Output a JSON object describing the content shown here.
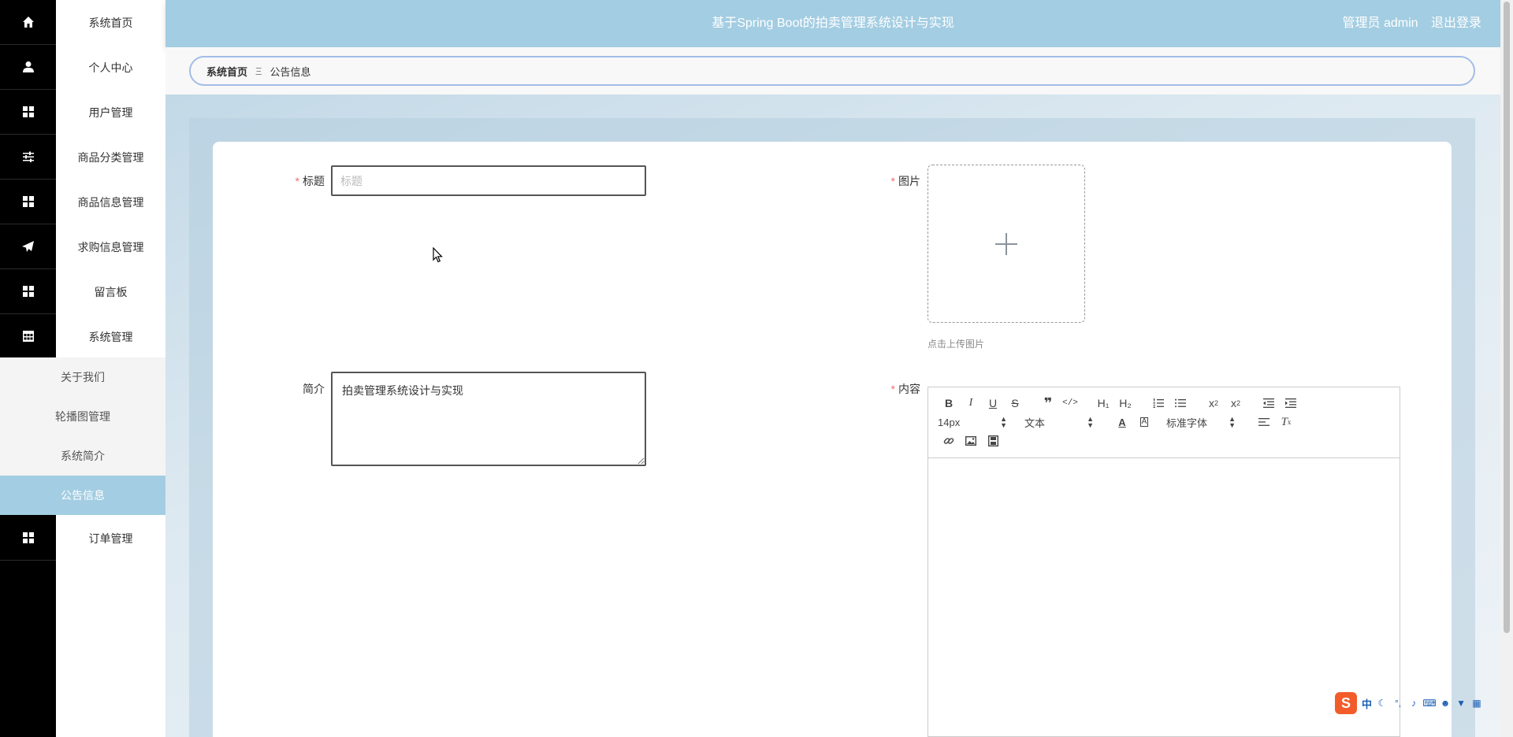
{
  "header": {
    "title": "基于Spring Boot的拍卖管理系统设计与实现",
    "user_role": "管理员 admin",
    "logout": "退出登录"
  },
  "sidebar": {
    "items": [
      {
        "label": "系统首页",
        "icon": "home-icon"
      },
      {
        "label": "个人中心",
        "icon": "user-icon"
      },
      {
        "label": "用户管理",
        "icon": "grid-icon"
      },
      {
        "label": "商品分类管理",
        "icon": "sliders-icon"
      },
      {
        "label": "商品信息管理",
        "icon": "grid-icon"
      },
      {
        "label": "求购信息管理",
        "icon": "paper-plane-icon"
      },
      {
        "label": "留言板",
        "icon": "grid-icon"
      },
      {
        "label": "系统管理",
        "icon": "table-icon"
      }
    ],
    "sub_items": [
      {
        "label": "关于我们"
      },
      {
        "label": "轮播图管理"
      },
      {
        "label": "系统简介"
      },
      {
        "label": "公告信息",
        "active": true
      }
    ],
    "last_item": {
      "label": "订单管理",
      "icon": "grid-icon"
    }
  },
  "breadcrumb": {
    "home": "系统首页",
    "separator": "Ξ",
    "current": "公告信息"
  },
  "form": {
    "title_label": "标题",
    "title_placeholder": "标题",
    "title_value": "",
    "image_label": "图片",
    "upload_tip": "点击上传图片",
    "intro_label": "简介",
    "intro_value": "拍卖管理系统设计与实现",
    "content_label": "内容",
    "required_mark": "*"
  },
  "editor": {
    "font_size": "14px",
    "header_select": "文本",
    "font_family": "标准字体",
    "h1": "H₁",
    "h2": "H₂"
  },
  "ime": {
    "mode": "中"
  },
  "colors": {
    "accent": "#a3cde2",
    "sidebar_dark": "#000000",
    "required": "#f56c6c",
    "breadcrumb_border": "#a3bde8"
  }
}
